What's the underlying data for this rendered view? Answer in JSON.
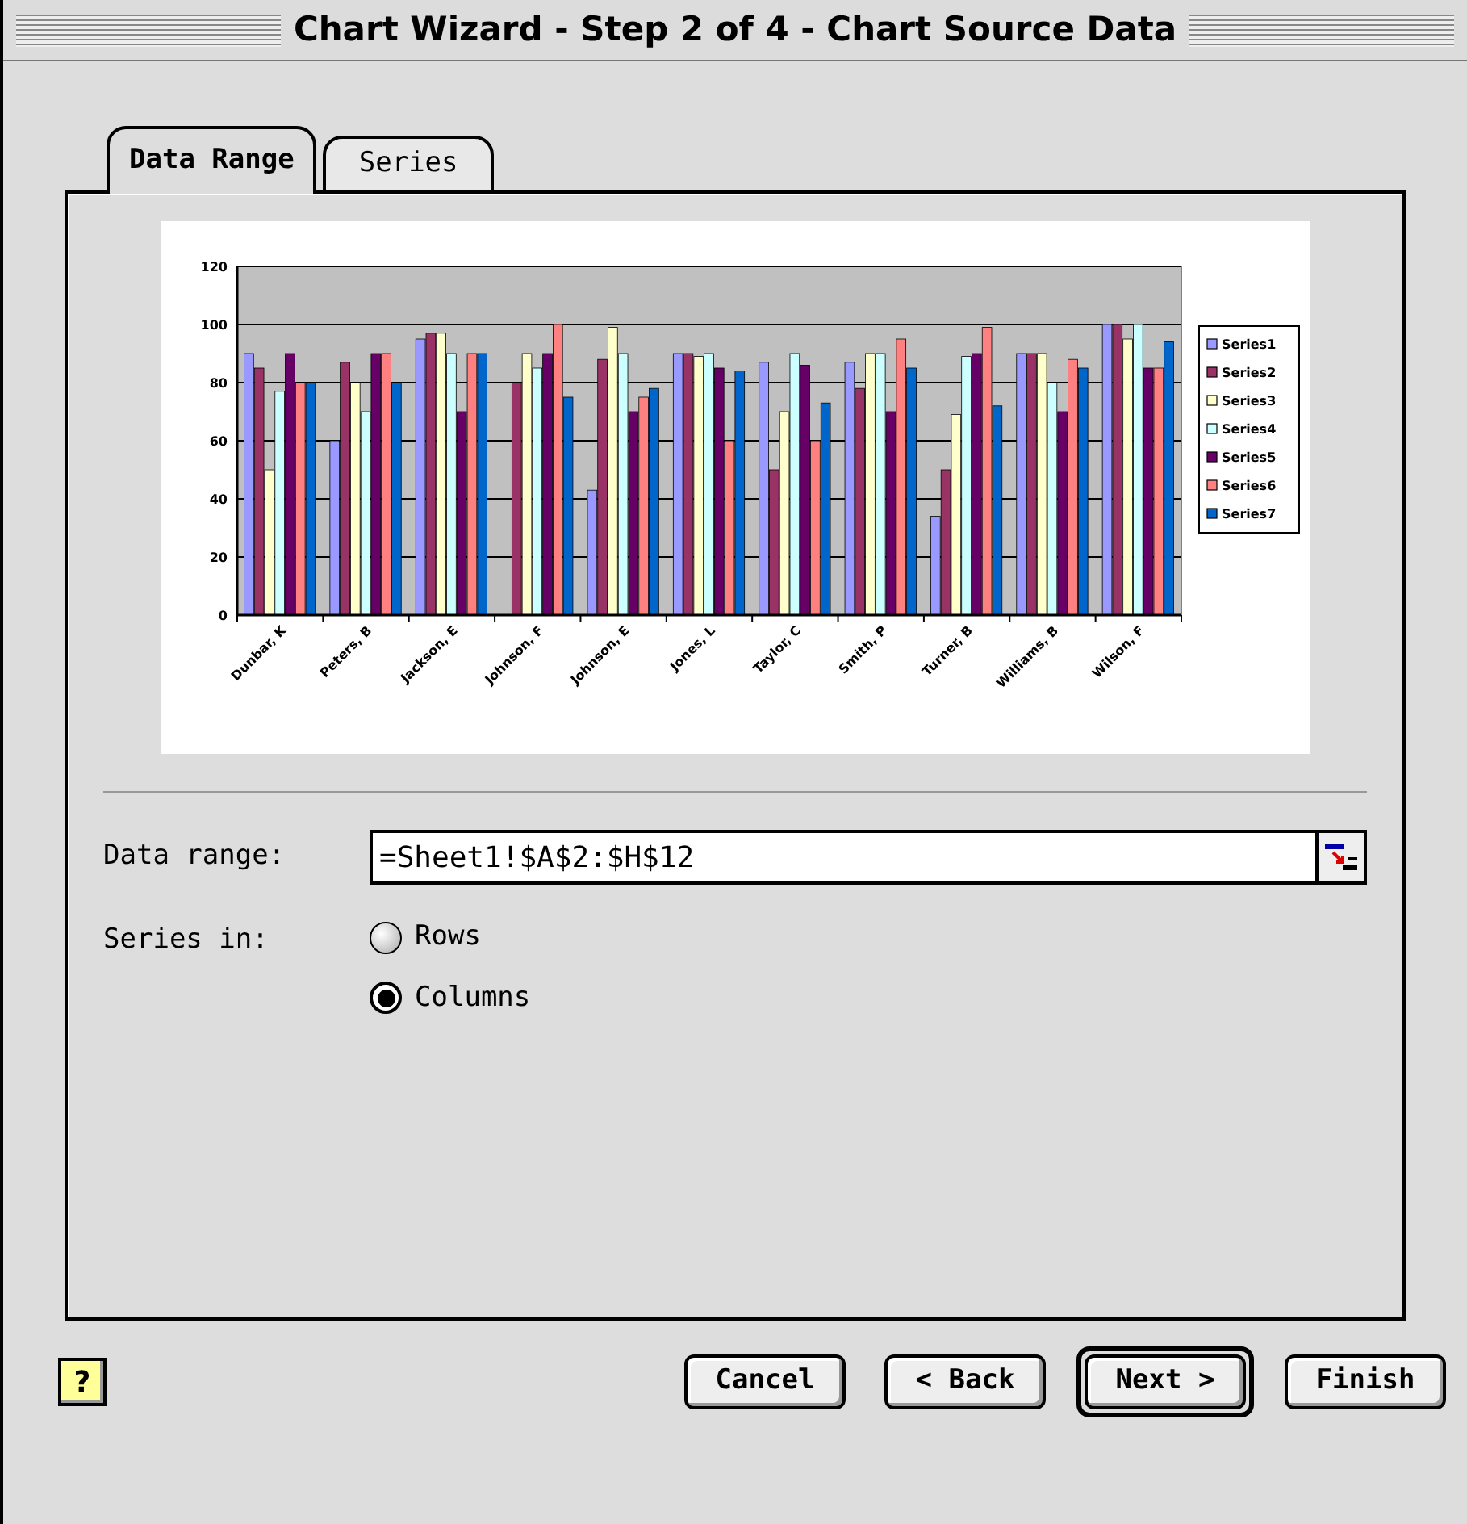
{
  "window": {
    "title": "Chart Wizard - Step 2 of 4 - Chart Source Data"
  },
  "tabs": [
    {
      "label": "Data Range",
      "selected": true
    },
    {
      "label": "Series",
      "selected": false
    }
  ],
  "preview": {
    "chart_data": {
      "type": "bar",
      "grid": true,
      "legend": true,
      "categories": [
        "Dunbar, K",
        "Peters, B",
        "Jackson, E",
        "Johnson, F",
        "Johnson, E",
        "Jones, L",
        "Taylor, C",
        "Smith, P",
        "Turner, B",
        "Williams, B",
        "Wilson, F"
      ],
      "ylim": [
        0,
        120
      ],
      "yticks": [
        0,
        20,
        40,
        60,
        80,
        100,
        120
      ],
      "series": [
        {
          "name": "Series1",
          "color": "#9999ff",
          "values": [
            90,
            60,
            95,
            0,
            43,
            90,
            87,
            87,
            34,
            90,
            100
          ]
        },
        {
          "name": "Series2",
          "color": "#993366",
          "values": [
            85,
            87,
            97,
            80,
            88,
            90,
            50,
            78,
            50,
            90,
            100
          ]
        },
        {
          "name": "Series3",
          "color": "#ffffcc",
          "values": [
            50,
            80,
            97,
            90,
            99,
            89,
            70,
            90,
            69,
            90,
            95
          ]
        },
        {
          "name": "Series4",
          "color": "#ccffff",
          "values": [
            77,
            70,
            90,
            85,
            90,
            90,
            90,
            90,
            89,
            80,
            100
          ]
        },
        {
          "name": "Series5",
          "color": "#660066",
          "values": [
            90,
            90,
            70,
            90,
            70,
            85,
            86,
            70,
            90,
            70,
            85
          ]
        },
        {
          "name": "Series6",
          "color": "#ff8080",
          "values": [
            80,
            90,
            90,
            100,
            75,
            60,
            60,
            95,
            99,
            88,
            85
          ]
        },
        {
          "name": "Series7",
          "color": "#0066cc",
          "values": [
            80,
            80,
            90,
            75,
            78,
            84,
            73,
            85,
            72,
            85,
            94
          ]
        }
      ]
    }
  },
  "data_range": {
    "label": "Data range:",
    "value": "=Sheet1!$A$2:$H$12"
  },
  "series_in": {
    "label": "Series in:",
    "options": [
      {
        "label": "Rows",
        "selected": false
      },
      {
        "label": "Columns",
        "selected": true
      }
    ]
  },
  "help": {
    "label": "?"
  },
  "buttons": [
    {
      "label": "Cancel",
      "default": false
    },
    {
      "label": "< Back",
      "default": false
    },
    {
      "label": "Next >",
      "default": true
    },
    {
      "label": "Finish",
      "default": false
    }
  ]
}
